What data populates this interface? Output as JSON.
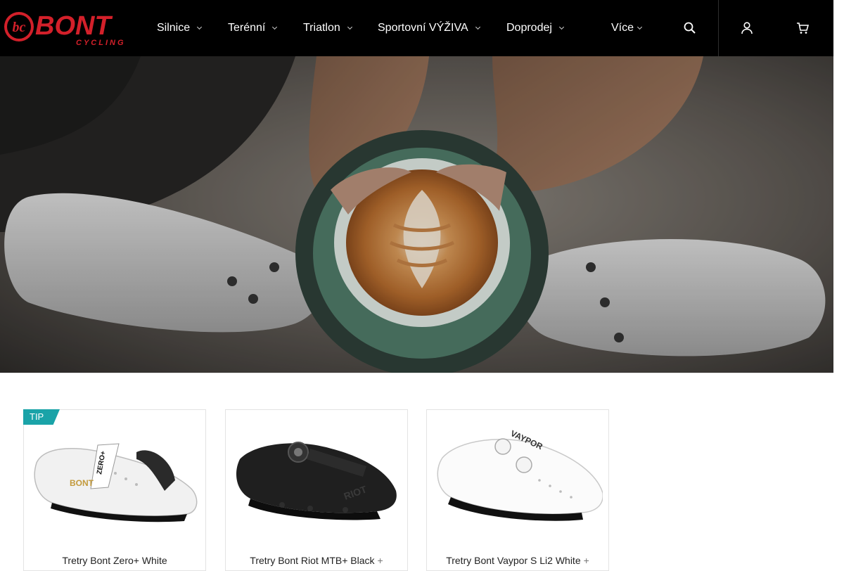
{
  "header": {
    "logo_text": "BONT",
    "logo_sub": "CYCLING",
    "nav": [
      {
        "label": "Silnice",
        "has_dropdown": true
      },
      {
        "label": "Terénní",
        "has_dropdown": true
      },
      {
        "label": "Triatlon",
        "has_dropdown": true
      },
      {
        "label": "Sportovní VÝŽIVA",
        "has_dropdown": true
      },
      {
        "label": "Doprodej",
        "has_dropdown": true
      },
      {
        "label": "Více",
        "has_dropdown": true
      }
    ],
    "icons": [
      "search-icon",
      "user-icon",
      "cart-icon"
    ]
  },
  "hero": {
    "description_icon": "coffee-cup-hero-image"
  },
  "products": [
    {
      "name": "Tretry Bont Zero+ White",
      "badge": "TIP",
      "show_plus": false
    },
    {
      "name": "Tretry Bont Riot MTB+ Black",
      "badge": "",
      "show_plus": true
    },
    {
      "name": "Tretry Bont Vaypor S Li2 White",
      "badge": "",
      "show_plus": true
    }
  ],
  "plus_symbol": "+",
  "colors": {
    "header_bg": "#000000",
    "brand_red": "#d3202a",
    "tip_badge": "#1aa3a8"
  }
}
